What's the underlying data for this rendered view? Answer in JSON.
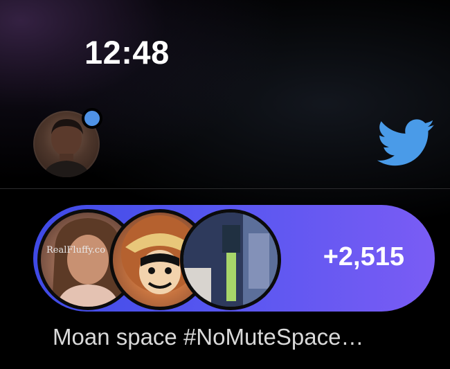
{
  "status_bar": {
    "time": "12:48"
  },
  "header": {
    "notification_dot_color": "#4f92e6",
    "logo_icon": "twitter-bird-icon",
    "logo_color": "#4a9be8"
  },
  "space_card": {
    "listener_count": "+2,515",
    "gradient_start": "#3f4ae6",
    "gradient_end": "#7a5cf4",
    "participants": [
      {
        "id": "participant-1",
        "watermark": "RealFluffy.co"
      },
      {
        "id": "participant-2"
      },
      {
        "id": "participant-3"
      }
    ],
    "title": "Moan space #NoMuteSpace…"
  }
}
